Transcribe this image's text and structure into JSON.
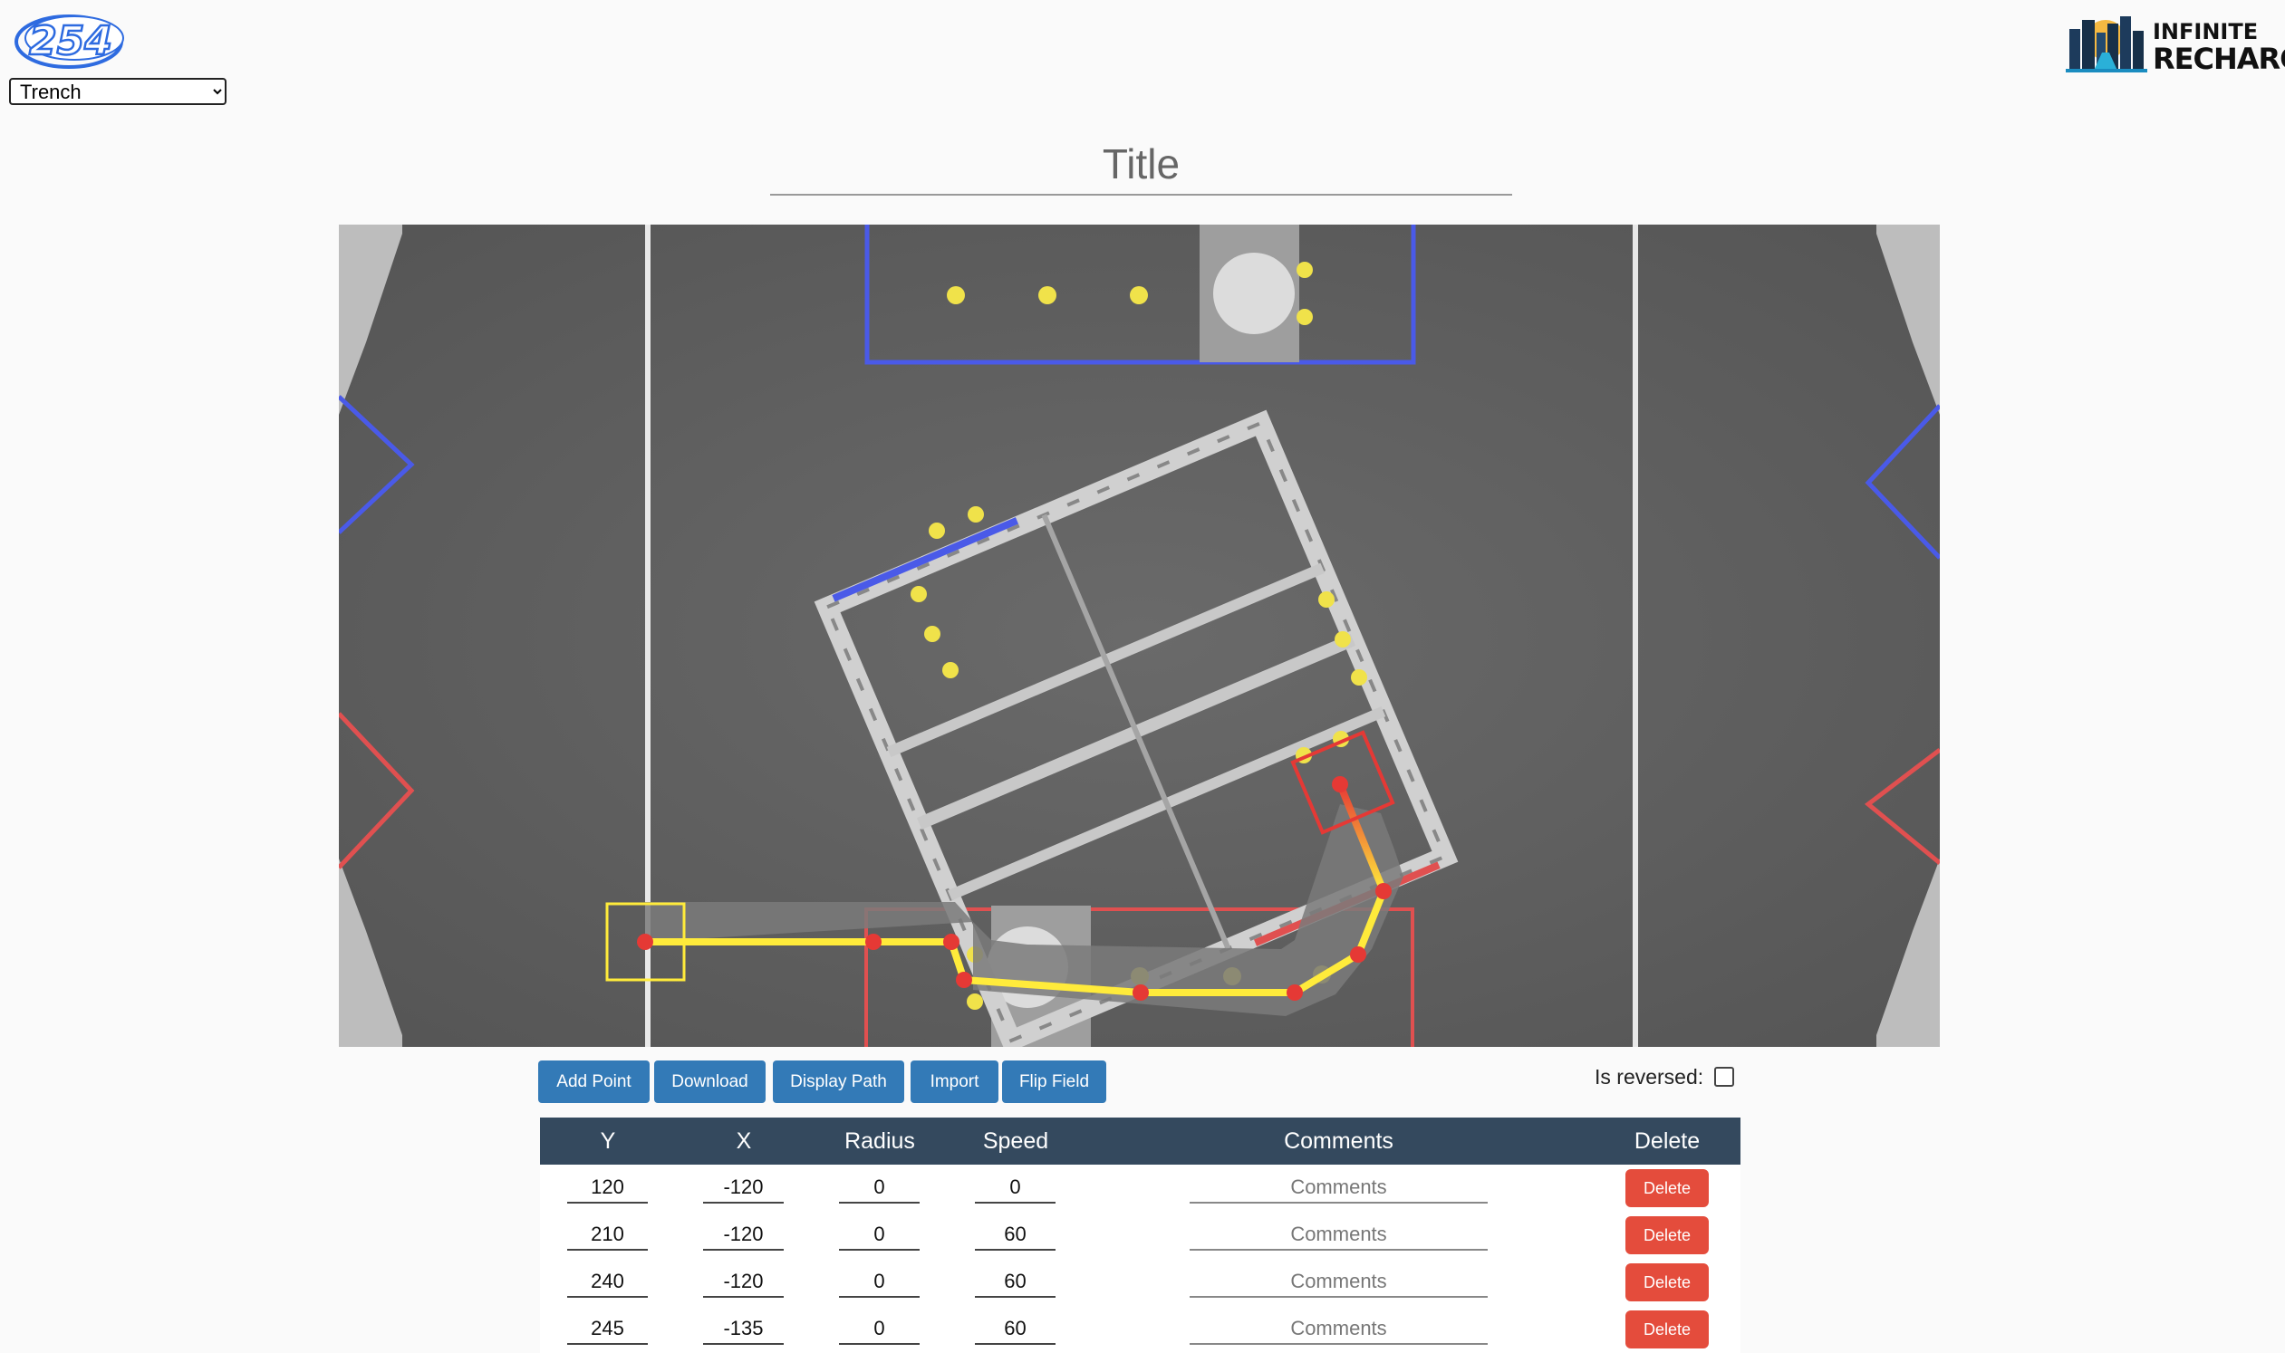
{
  "header": {
    "team_logo_text": "254",
    "preset": {
      "selected": "Trench",
      "options": [
        "Trench"
      ]
    },
    "game_logo": {
      "line1": "INFINITE",
      "line2": "RECHARGE"
    }
  },
  "title_input": {
    "value": "",
    "placeholder": "Title"
  },
  "toolbar": {
    "add_point": "Add Point",
    "download": "Download",
    "display_path": "Display Path",
    "import": "Import",
    "flip_field": "Flip Field",
    "is_reversed_label": "Is reversed:",
    "is_reversed": false
  },
  "table": {
    "headers": {
      "y": "Y",
      "x": "X",
      "radius": "Radius",
      "speed": "Speed",
      "comments": "Comments",
      "delete": "Delete"
    },
    "comment_placeholder": "Comments",
    "delete_label": "Delete",
    "rows": [
      {
        "y": "120",
        "x": "-120",
        "radius": "0",
        "speed": "0",
        "comments": ""
      },
      {
        "y": "210",
        "x": "-120",
        "radius": "0",
        "speed": "60",
        "comments": ""
      },
      {
        "y": "240",
        "x": "-120",
        "radius": "0",
        "speed": "60",
        "comments": ""
      },
      {
        "y": "245",
        "x": "-135",
        "radius": "0",
        "speed": "60",
        "comments": ""
      }
    ]
  },
  "colors": {
    "path": "#ffeb3b",
    "waypoint": "#e53935",
    "start_box": "#ffeb3b",
    "end_box": "#e53935",
    "alliance_blue": "#4a5ae8",
    "alliance_red": "#e05050",
    "button": "#337ab7",
    "delete": "#e44c3c",
    "table_header": "#34495e"
  }
}
